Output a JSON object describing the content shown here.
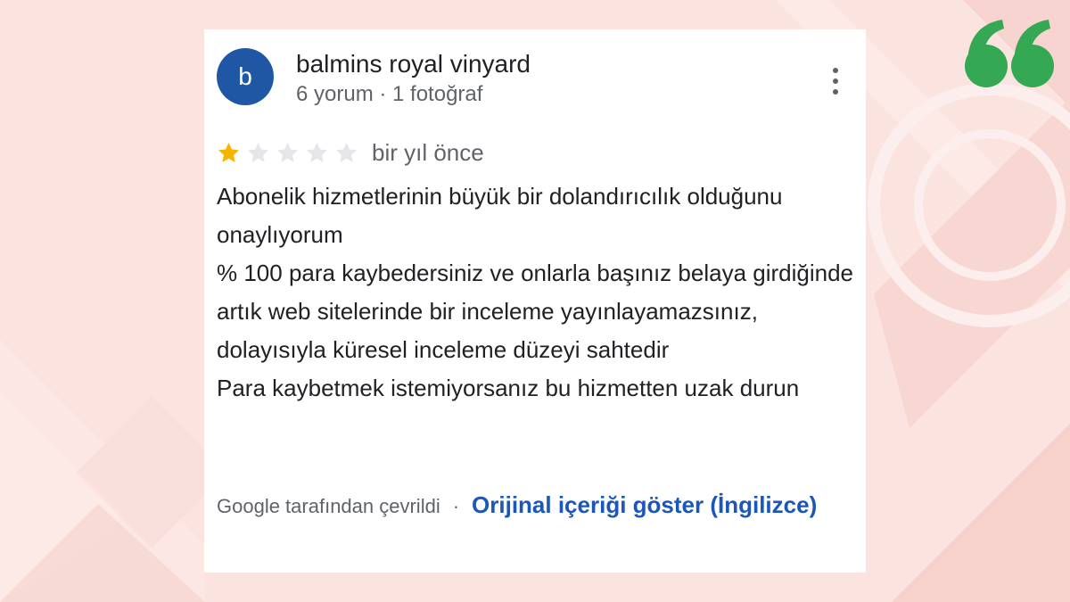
{
  "colors": {
    "background": "#fbe3e0",
    "avatar": "#1f57a5",
    "star_filled": "#f6b400",
    "star_empty": "#e4e6e9",
    "quote_mark": "#34a853",
    "link": "#1a57b8"
  },
  "quote_icon": "double-quote-icon",
  "review": {
    "avatar_letter": "b",
    "reviewer_name": "balmins royal vinyard",
    "reviewer_meta": "6 yorum · 1 fotoğraf",
    "more_icon": "more-vertical-icon",
    "rating": 1,
    "rating_max": 5,
    "date": "bir yıl önce",
    "body": [
      "Abonelik hizmetlerinin büyük bir dolandırıcılık olduğunu onaylıyorum",
      "% 100 para kaybedersiniz ve onlarla başınız belaya girdiğinde artık web sitelerinde bir inceleme yayınlayamazsınız, dolayısıyla küresel inceleme düzeyi sahtedir",
      "Para kaybetmek istemiyorsanız bu hizmetten uzak durun"
    ],
    "translated_by": "Google tarafından çevrildi",
    "separator": "·",
    "show_original": "Orijinal içeriği göster (İngilizce)"
  }
}
